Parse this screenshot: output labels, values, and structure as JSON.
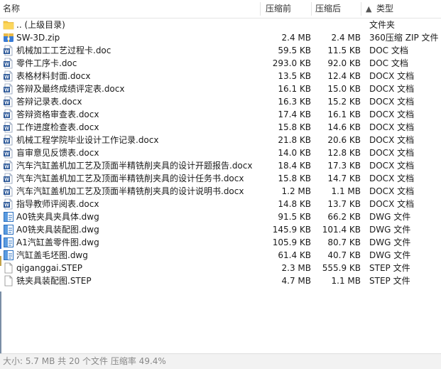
{
  "header": {
    "name": "名称",
    "original_size": "压缩前",
    "compressed_size": "压缩后",
    "type": "类型",
    "sort_arrow": "▲"
  },
  "files": [
    {
      "icon": "folder-icon",
      "name": ".. (上级目录)",
      "orig": "",
      "comp": "",
      "type": "文件夹"
    },
    {
      "icon": "zip-icon",
      "name": "SW-3D.zip",
      "orig": "2.4 MB",
      "comp": "2.4 MB",
      "type": "360压缩 ZIP 文件"
    },
    {
      "icon": "word-doc-icon",
      "name": "机械加工工艺过程卡.doc",
      "orig": "59.5 KB",
      "comp": "11.5 KB",
      "type": "DOC 文档"
    },
    {
      "icon": "word-doc-icon",
      "name": "零件工序卡.doc",
      "orig": "293.0 KB",
      "comp": "92.0 KB",
      "type": "DOC 文档"
    },
    {
      "icon": "word-doc-icon",
      "name": "表格材料封面.docx",
      "orig": "13.5 KB",
      "comp": "12.4 KB",
      "type": "DOCX 文档"
    },
    {
      "icon": "word-doc-icon",
      "name": "答辩及最终成绩评定表.docx",
      "orig": "16.1 KB",
      "comp": "15.0 KB",
      "type": "DOCX 文档"
    },
    {
      "icon": "word-doc-icon",
      "name": "答辩记录表.docx",
      "orig": "16.3 KB",
      "comp": "15.2 KB",
      "type": "DOCX 文档"
    },
    {
      "icon": "word-doc-icon",
      "name": "答辩资格审查表.docx",
      "orig": "17.4 KB",
      "comp": "16.1 KB",
      "type": "DOCX 文档"
    },
    {
      "icon": "word-doc-icon",
      "name": "工作进度检查表.docx",
      "orig": "15.8 KB",
      "comp": "14.6 KB",
      "type": "DOCX 文档"
    },
    {
      "icon": "word-doc-icon",
      "name": "机械工程学院毕业设计工作记录.docx",
      "orig": "21.8 KB",
      "comp": "20.6 KB",
      "type": "DOCX 文档"
    },
    {
      "icon": "word-doc-icon",
      "name": "盲审意见反馈表.docx",
      "orig": "14.0 KB",
      "comp": "12.8 KB",
      "type": "DOCX 文档"
    },
    {
      "icon": "word-doc-icon",
      "name": "汽车汽缸盖机加工艺及顶面半精铣削夹具的设计开题报告.docx",
      "orig": "18.4 KB",
      "comp": "17.3 KB",
      "type": "DOCX 文档"
    },
    {
      "icon": "word-doc-icon",
      "name": "汽车汽缸盖机加工艺及顶面半精铣削夹具的设计任务书.docx",
      "orig": "15.8 KB",
      "comp": "14.7 KB",
      "type": "DOCX 文档"
    },
    {
      "icon": "word-doc-icon",
      "name": "汽车汽缸盖机加工艺及顶面半精铣削夹具的设计说明书.docx",
      "orig": "1.2 MB",
      "comp": "1.1 MB",
      "type": "DOCX 文档"
    },
    {
      "icon": "word-doc-icon",
      "name": "指导教师评阅表.docx",
      "orig": "14.8 KB",
      "comp": "13.7 KB",
      "type": "DOCX 文档"
    },
    {
      "icon": "dwg-icon",
      "name": "A0铣夹具夹具体.dwg",
      "orig": "91.5 KB",
      "comp": "66.2 KB",
      "type": "DWG 文件"
    },
    {
      "icon": "dwg-icon",
      "name": "A0铣夹具装配图.dwg",
      "orig": "145.9 KB",
      "comp": "101.4 KB",
      "type": "DWG 文件"
    },
    {
      "icon": "dwg-icon",
      "name": "A1汽缸盖零件图.dwg",
      "orig": "105.9 KB",
      "comp": "80.7 KB",
      "type": "DWG 文件"
    },
    {
      "icon": "dwg-icon",
      "name": "汽缸盖毛坯图.dwg",
      "orig": "61.4 KB",
      "comp": "40.7 KB",
      "type": "DWG 文件"
    },
    {
      "icon": "step-file-icon",
      "name": "qiganggai.STEP",
      "orig": "2.3 MB",
      "comp": "555.9 KB",
      "type": "STEP 文件"
    },
    {
      "icon": "step-file-icon",
      "name": "铣夹具装配图.STEP",
      "orig": "4.7 MB",
      "comp": "1.1 MB",
      "type": "STEP 文件"
    }
  ],
  "status": {
    "text": "大小: 5.7 MB 共 20 个文件 压缩率 49.4%"
  },
  "colors": {
    "folder": "#f5c542",
    "word": "#2b5797",
    "dwg": "#2a6fbf",
    "zip": "#3a7bd5"
  }
}
